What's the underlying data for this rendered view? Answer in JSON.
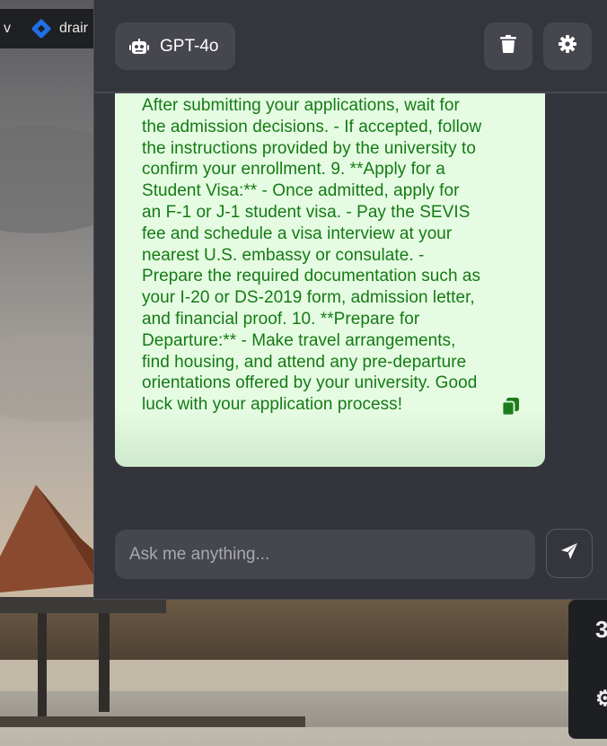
{
  "background": {
    "bookmarks": [
      {
        "label": "v"
      },
      {
        "label": "drair",
        "icon": "blue-diamond-icon"
      }
    ],
    "dock_glyphs": [
      "3",
      "⚙"
    ]
  },
  "header": {
    "model_label": "GPT-4o",
    "model_icon": "robot-icon",
    "delete_icon": "trash-icon",
    "settings_icon": "gear-icon"
  },
  "message": {
    "text": "After submitting your applications, wait for\nthe admission decisions. - If accepted, follow\nthe instructions provided by the university to\nconfirm your enrollment. 9. **Apply for a\nStudent Visa:** - Once admitted, apply for\nan F-1 or J-1 student visa. - Pay the SEVIS\nfee and schedule a visa interview at your\nnearest U.S. embassy or consulate. -\nPrepare the required documentation such as\nyour I-20 or DS-2019 form, admission letter,\nand financial proof. 10. **Prepare for\nDeparture:** - Make travel arrangements,\nfind housing, and attend any pre-departure\norientations offered by your university. Good\nluck with your application process!",
    "copy_icon": "copy-icon",
    "bubble_color": "#e5fce3",
    "text_color": "#157a14"
  },
  "input": {
    "placeholder": "Ask me anything...",
    "value": "",
    "send_icon": "send-icon"
  }
}
